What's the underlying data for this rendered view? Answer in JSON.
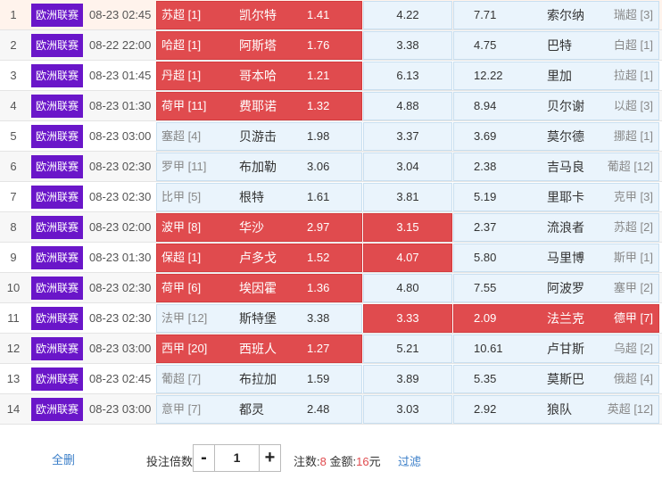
{
  "rows": [
    {
      "idx": "1",
      "league": "欧洲联赛",
      "time": "08-23 02:45",
      "home_rank": "苏超 [1]",
      "home": "凯尔特",
      "home_odds": "1.41",
      "draw": "4.22",
      "away_odds": "7.71",
      "away": "索尔纳",
      "away_rank": "瑞超 [3]",
      "sel": "home",
      "hl": true
    },
    {
      "idx": "2",
      "league": "欧洲联赛",
      "time": "08-22 22:00",
      "home_rank": "哈超 [1]",
      "home": "阿斯塔",
      "home_odds": "1.76",
      "draw": "3.38",
      "away_odds": "4.75",
      "away": "巴特",
      "away_rank": "白超 [1]",
      "sel": "home",
      "hl": false
    },
    {
      "idx": "3",
      "league": "欧洲联赛",
      "time": "08-23 01:45",
      "home_rank": "丹超 [1]",
      "home": "哥本哈",
      "home_odds": "1.21",
      "draw": "6.13",
      "away_odds": "12.22",
      "away": "里加",
      "away_rank": "拉超 [1]",
      "sel": "home",
      "hl": false
    },
    {
      "idx": "4",
      "league": "欧洲联赛",
      "time": "08-23 01:30",
      "home_rank": "荷甲 [11]",
      "home": "费耶诺",
      "home_odds": "1.32",
      "draw": "4.88",
      "away_odds": "8.94",
      "away": "贝尔谢",
      "away_rank": "以超 [3]",
      "sel": "home",
      "hl": false
    },
    {
      "idx": "5",
      "league": "欧洲联赛",
      "time": "08-23 03:00",
      "home_rank": "塞超 [4]",
      "home": "贝游击",
      "home_odds": "1.98",
      "draw": "3.37",
      "away_odds": "3.69",
      "away": "莫尔德",
      "away_rank": "挪超 [1]",
      "sel": "",
      "hl": false
    },
    {
      "idx": "6",
      "league": "欧洲联赛",
      "time": "08-23 02:30",
      "home_rank": "罗甲 [11]",
      "home": "布加勒",
      "home_odds": "3.06",
      "draw": "3.04",
      "away_odds": "2.38",
      "away": "吉马良",
      "away_rank": "葡超 [12]",
      "sel": "",
      "hl": false
    },
    {
      "idx": "7",
      "league": "欧洲联赛",
      "time": "08-23 02:30",
      "home_rank": "比甲 [5]",
      "home": "根特",
      "home_odds": "1.61",
      "draw": "3.81",
      "away_odds": "5.19",
      "away": "里耶卡",
      "away_rank": "克甲 [3]",
      "sel": "",
      "hl": false
    },
    {
      "idx": "8",
      "league": "欧洲联赛",
      "time": "08-23 02:00",
      "home_rank": "波甲 [8]",
      "home": "华沙",
      "home_odds": "2.97",
      "draw": "3.15",
      "away_odds": "2.37",
      "away": "流浪者",
      "away_rank": "苏超 [2]",
      "sel": "home-draw",
      "hl": false
    },
    {
      "idx": "9",
      "league": "欧洲联赛",
      "time": "08-23 01:30",
      "home_rank": "保超 [1]",
      "home": "卢多戈",
      "home_odds": "1.52",
      "draw": "4.07",
      "away_odds": "5.80",
      "away": "马里博",
      "away_rank": "斯甲 [1]",
      "sel": "home-draw",
      "hl": false
    },
    {
      "idx": "10",
      "league": "欧洲联赛",
      "time": "08-23 02:30",
      "home_rank": "荷甲 [6]",
      "home": "埃因霍",
      "home_odds": "1.36",
      "draw": "4.80",
      "away_odds": "7.55",
      "away": "阿波罗",
      "away_rank": "塞甲 [2]",
      "sel": "home",
      "hl": false
    },
    {
      "idx": "11",
      "league": "欧洲联赛",
      "time": "08-23 02:30",
      "home_rank": "法甲 [12]",
      "home": "斯特堡",
      "home_odds": "3.38",
      "draw": "3.33",
      "away_odds": "2.09",
      "away": "法兰克",
      "away_rank": "德甲 [7]",
      "sel": "draw-away",
      "hl": false
    },
    {
      "idx": "12",
      "league": "欧洲联赛",
      "time": "08-23 03:00",
      "home_rank": "西甲 [20]",
      "home": "西班人",
      "home_odds": "1.27",
      "draw": "5.21",
      "away_odds": "10.61",
      "away": "卢甘斯",
      "away_rank": "乌超 [2]",
      "sel": "home",
      "hl": false
    },
    {
      "idx": "13",
      "league": "欧洲联赛",
      "time": "08-23 02:45",
      "home_rank": "葡超 [7]",
      "home": "布拉加",
      "home_odds": "1.59",
      "draw": "3.89",
      "away_odds": "5.35",
      "away": "莫斯巴",
      "away_rank": "俄超 [4]",
      "sel": "",
      "hl": false
    },
    {
      "idx": "14",
      "league": "欧洲联赛",
      "time": "08-23 03:00",
      "home_rank": "意甲 [7]",
      "home": "都灵",
      "home_odds": "2.48",
      "draw": "3.03",
      "away_odds": "2.92",
      "away": "狼队",
      "away_rank": "英超 [12]",
      "sel": "",
      "hl": false
    }
  ],
  "footer": {
    "delete_all": "全删",
    "multiplier_label": "投注倍数:",
    "minus": "-",
    "multiplier_value": "1",
    "plus": "+",
    "bets_label": "注数:",
    "bets_value": "8",
    "amount_label": "金额:",
    "amount_value": "16",
    "amount_unit": "元",
    "filter": "过滤"
  },
  "colors": {
    "selected": "#e04b4e",
    "league_badge": "#6a16c9",
    "link": "#3a7ec8"
  }
}
